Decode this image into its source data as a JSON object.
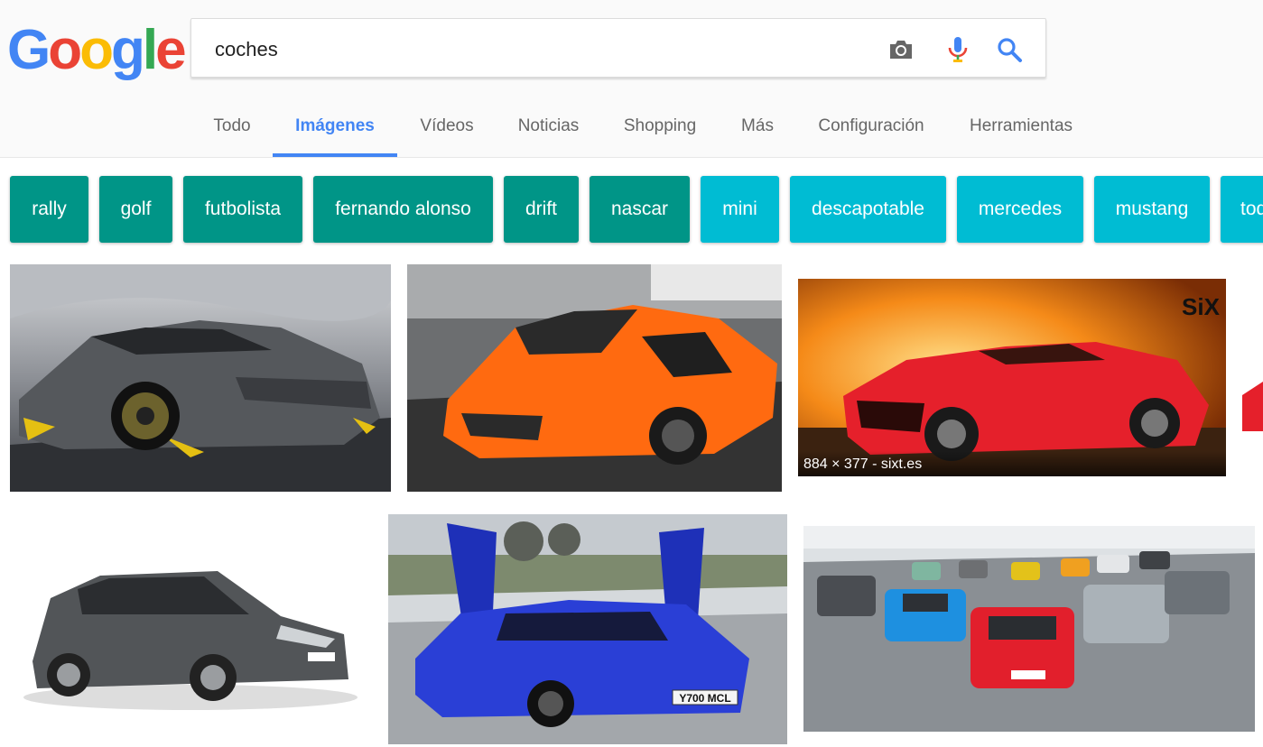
{
  "logo": {
    "text": "Google",
    "letters": [
      "G",
      "o",
      "o",
      "g",
      "l",
      "e"
    ],
    "colors": [
      "#4285f4",
      "#ea4335",
      "#fbbc05",
      "#4285f4",
      "#34a853",
      "#ea4335"
    ]
  },
  "search": {
    "query": "coches",
    "camera_icon": "camera-icon",
    "mic_icon": "microphone-icon",
    "search_icon": "search-icon"
  },
  "tabs": [
    {
      "label": "Todo",
      "active": false
    },
    {
      "label": "Imágenes",
      "active": true
    },
    {
      "label": "Vídeos",
      "active": false
    },
    {
      "label": "Noticias",
      "active": false
    },
    {
      "label": "Shopping",
      "active": false
    },
    {
      "label": "Más",
      "active": false
    },
    {
      "label": "Configuración",
      "active": false
    },
    {
      "label": "Herramientas",
      "active": false
    }
  ],
  "chips": [
    {
      "label": "rally",
      "color": "#009587"
    },
    {
      "label": "golf",
      "color": "#009587"
    },
    {
      "label": "futbolista",
      "color": "#009587"
    },
    {
      "label": "fernando alonso",
      "color": "#009587"
    },
    {
      "label": "drift",
      "color": "#009587"
    },
    {
      "label": "nascar",
      "color": "#009587"
    },
    {
      "label": "mini",
      "color": "#00bcd3"
    },
    {
      "label": "descapotable",
      "color": "#00bcd3"
    },
    {
      "label": "mercedes",
      "color": "#00bcd3"
    },
    {
      "label": "mustang",
      "color": "#00bcd3"
    },
    {
      "label": "todo",
      "color": "#00bcd3"
    }
  ],
  "results": {
    "caption_sixt": "884 × 377 - sixt.es",
    "sixt_logo": "SiX",
    "plate_1": "Y700 MCL"
  },
  "colors": {
    "accent": "#4285f4",
    "chip_teal": "#009587",
    "chip_cyan": "#00bcd3"
  }
}
